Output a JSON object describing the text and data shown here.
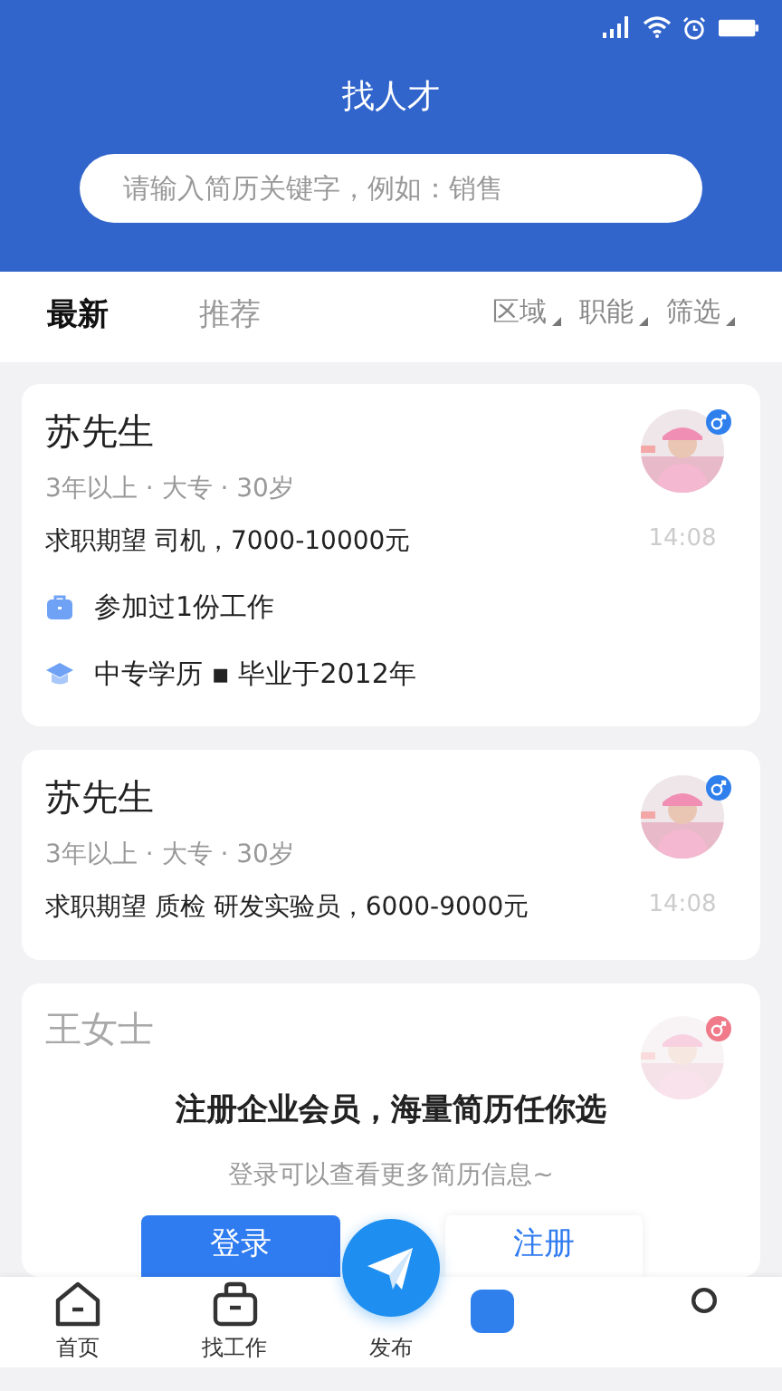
{
  "header": {
    "title": "找人才",
    "search": {
      "placeholder": "请输入简历关键字，例如：销售"
    }
  },
  "tabs": [
    {
      "label": "最新",
      "selected": true
    },
    {
      "label": "推荐",
      "selected": false
    }
  ],
  "filters": [
    "区域",
    "职能",
    "筛选"
  ],
  "resumes": [
    {
      "name": "苏先生",
      "color": "#2f80ed",
      "meta": "3年以上 · 大专 · 30岁",
      "expectation": "求职期望 司机，7000-10000元",
      "time": "14:08",
      "details": [
        {
          "kind": "work",
          "text": "参加过1份工作"
        },
        {
          "kind": "education",
          "text": "中专学历 ▪ 毕业于2012年"
        }
      ]
    },
    {
      "name": "苏先生",
      "color": "#2f80ed",
      "meta": "3年以上 · 大专 · 30岁",
      "expectation": "求职期望 质检 研发实验员，6000-9000元",
      "time": "14:08"
    }
  ],
  "locked_resume": {
    "name": "王女士",
    "color": "#f07a8a"
  },
  "login_prompt": {
    "title": "注册企业会员，海量简历任你选",
    "subtitle": "登录可以查看更多简历信息~",
    "login": "登录",
    "register": "注册"
  },
  "bottom_nav": [
    {
      "kind": "home",
      "label": "首页",
      "selected": false
    },
    {
      "kind": "bag",
      "label": "找工作",
      "selected": false
    },
    {
      "kind": "publish",
      "label": "发布",
      "selected": false
    },
    {
      "kind": "talent",
      "selected": true
    },
    {
      "kind": "profile",
      "selected": false
    }
  ]
}
